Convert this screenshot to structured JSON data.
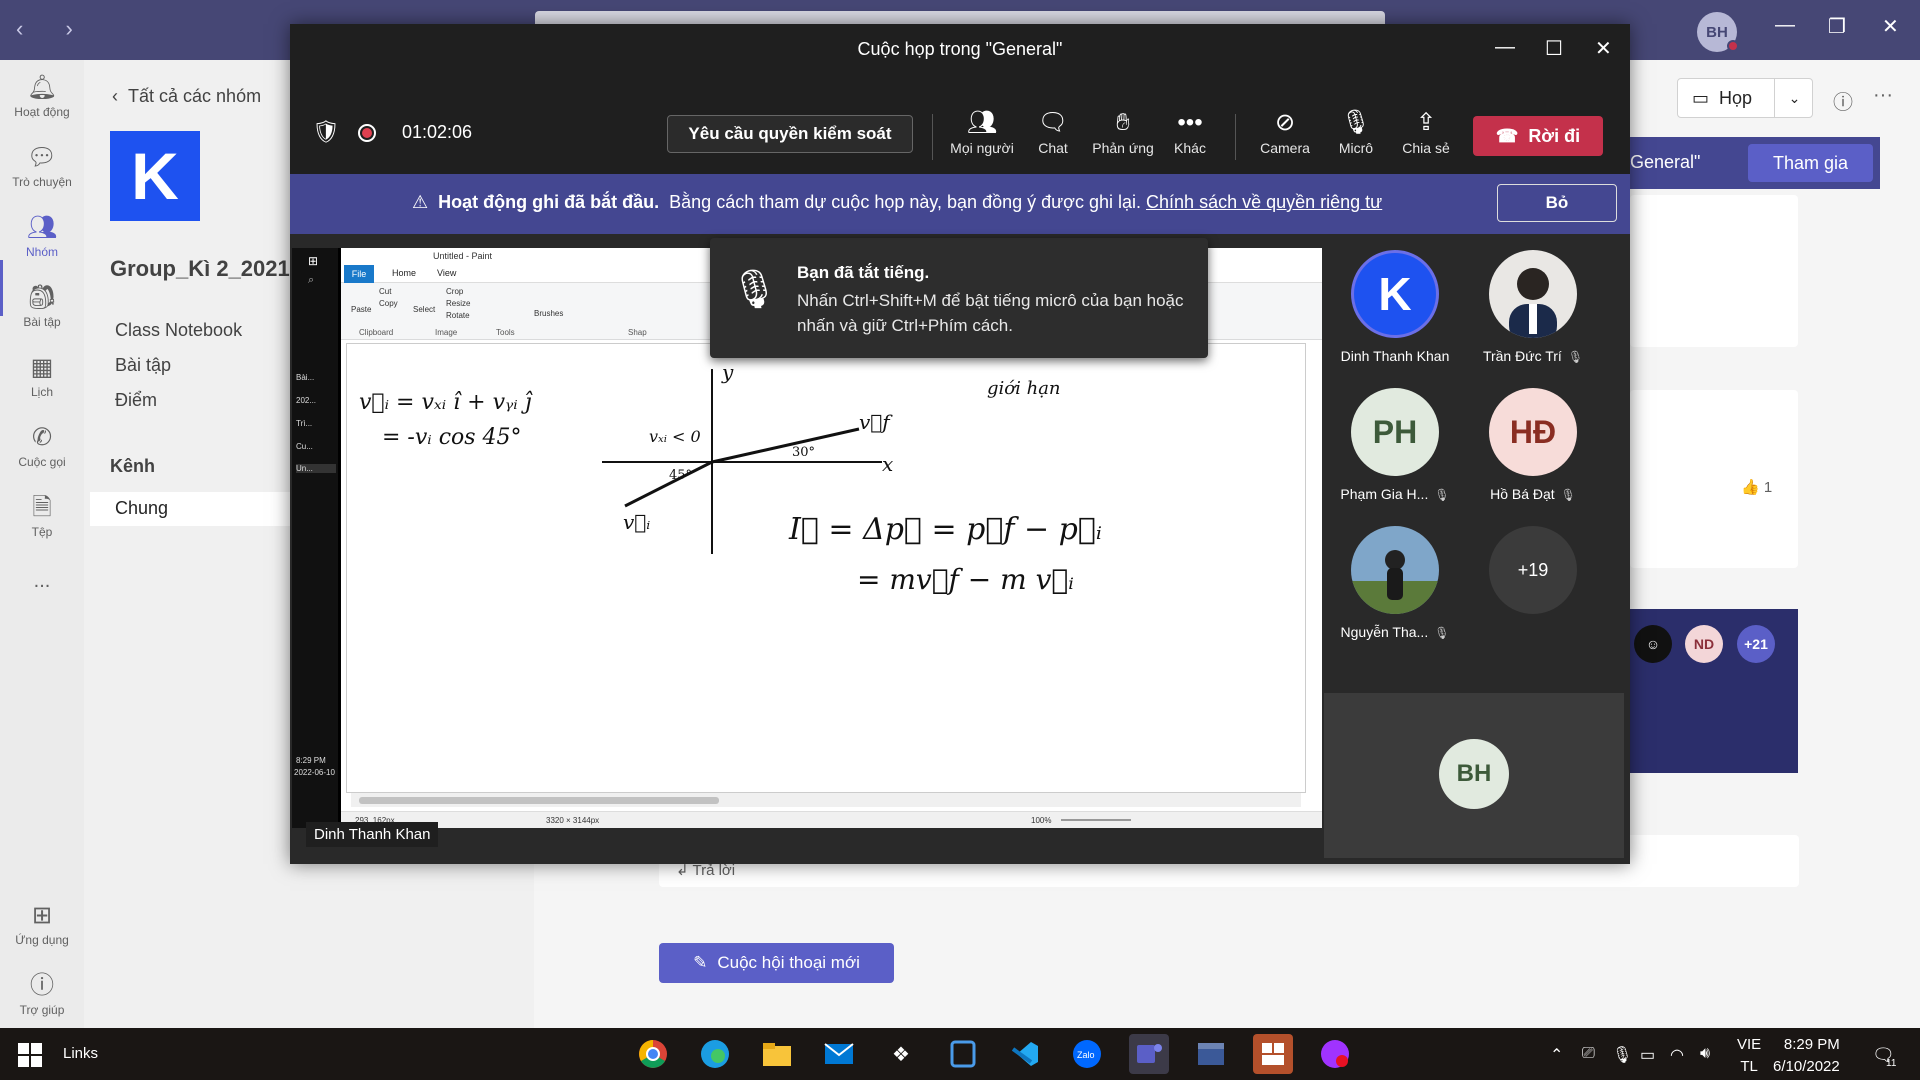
{
  "teams": {
    "user_initials": "BH",
    "rail": [
      {
        "label": "Hoạt động",
        "icon": "bell-icon"
      },
      {
        "label": "Trò chuyện",
        "icon": "chat-icon"
      },
      {
        "label": "Nhóm",
        "icon": "teams-icon"
      },
      {
        "label": "Bài tập",
        "icon": "assignments-icon"
      },
      {
        "label": "Lịch",
        "icon": "calendar-icon"
      },
      {
        "label": "Cuộc gọi",
        "icon": "phone-icon"
      },
      {
        "label": "Tệp",
        "icon": "file-icon"
      },
      {
        "label": "...",
        "icon": "more-icon"
      },
      {
        "label": "Ứng dụng",
        "icon": "apps-icon"
      },
      {
        "label": "Trợ giúp",
        "icon": "help-icon"
      }
    ],
    "panel": {
      "back_label": "Tất cả các nhóm",
      "team_initial": "K",
      "team_name": "Group_Kì 2_2021-",
      "links": [
        "Class Notebook",
        "Bài tập",
        "Điểm"
      ],
      "channels_heading": "Kênh",
      "channel": "Chung"
    },
    "channel": {
      "meet_label": "Họp",
      "join_text": "General\"",
      "join_label": "Tham gia",
      "like_count": "1",
      "avatars": [
        "ND",
        "+21"
      ],
      "reply_label": "Trả lời",
      "new_conversation": "Cuộc hội thoại mới"
    }
  },
  "meeting": {
    "title": "Cuộc họp trong \"General\"",
    "timer": "01:02:06",
    "request_control": "Yêu cầu quyền kiểm soát",
    "toolbar": [
      {
        "label": "Mọi người",
        "icon": "people-icon"
      },
      {
        "label": "Chat",
        "icon": "chat-icon"
      },
      {
        "label": "Phản ứng",
        "icon": "reaction-icon"
      },
      {
        "label": "Khác",
        "icon": "more-icon"
      },
      {
        "label": "Camera",
        "icon": "camera-off-icon"
      },
      {
        "label": "Micrô",
        "icon": "mic-off-icon"
      },
      {
        "label": "Chia sẻ",
        "icon": "share-icon"
      }
    ],
    "leave_label": "Rời đi",
    "recording_banner": {
      "bold": "Hoạt động ghi đã bắt đầu.",
      "text": "Bằng cách tham dự cuộc họp này, bạn đồng ý được ghi lại.",
      "link": "Chính sách về quyền riêng tư",
      "dismiss": "Bỏ"
    },
    "toast": {
      "title": "Bạn đã tắt tiếng.",
      "body": "Nhấn Ctrl+Shift+M để bật tiếng micrô của bạn hoặc nhấn và giữ Ctrl+Phím cách."
    },
    "presenter_tag": "Dinh Thanh Khan",
    "participants": [
      {
        "name": "Dinh Thanh Khan",
        "initials": "K",
        "muted": false
      },
      {
        "name": "Trần Đức Trí",
        "initials": "",
        "muted": true
      },
      {
        "name": "Phạm Gia H...",
        "initials": "PH",
        "muted": true
      },
      {
        "name": "Hồ Bá Đạt",
        "initials": "HĐ",
        "muted": true
      },
      {
        "name": "Nguyễn Tha...",
        "initials": "",
        "muted": true
      },
      {
        "name": "",
        "initials": "+19",
        "muted": false
      }
    ],
    "self_initials": "BH"
  },
  "paint": {
    "title": "Untitled - Paint",
    "tabs": [
      "File",
      "Home",
      "View"
    ],
    "clipboard": {
      "paste": "Paste",
      "cut": "Cut",
      "copy": "Copy",
      "group": "Clipboard"
    },
    "image": {
      "select": "Select",
      "crop": "Crop",
      "resize": "Resize",
      "rotate": "Rotate",
      "group": "Image"
    },
    "tools_group": "Tools",
    "brushes": "Brushes",
    "shapes_group": "Shap",
    "status_pos": "293, 162px",
    "status_size": "3320 × 3144px",
    "zoom": "100%",
    "left_taskbar": [
      "Bài...",
      "202...",
      "Trì...",
      "Cu...",
      "Un..."
    ],
    "left_time": "8:29 PM",
    "left_date": "2022-06-10",
    "handwriting": {
      "vi_eq": "v⃗ᵢ = vₓᵢ î + vᵧᵢ ĵ",
      "vx_eq": "= -vᵢ cos 45°",
      "axis_y": "y",
      "axis_x": "x",
      "vxi": "vₓᵢ < 0",
      "angle45": "45°",
      "angle30": "30°",
      "vf": "v⃗f",
      "vi": "v⃗ᵢ",
      "gioi": "giới hạn",
      "impulse": "I⃗ = Δp⃗ = p⃗f − p⃗ᵢ",
      "impulse2": "= mv⃗f − m v⃗ᵢ"
    }
  },
  "windows": {
    "links_label": "Links",
    "lang": "VIE",
    "lang2": "TL",
    "time": "8:29 PM",
    "date": "6/10/2022",
    "notif_count": "11"
  }
}
